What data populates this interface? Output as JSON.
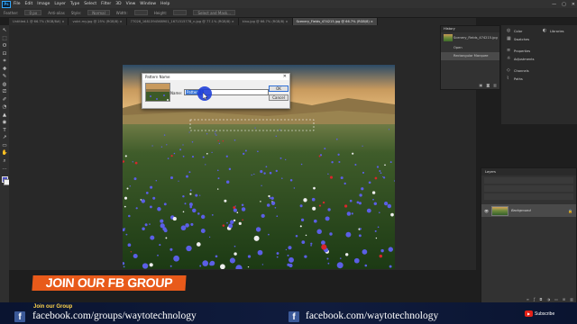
{
  "menubar": {
    "logo": "Ps",
    "items": [
      "File",
      "Edit",
      "Image",
      "Layer",
      "Type",
      "Select",
      "Filter",
      "3D",
      "View",
      "Window",
      "Help"
    ],
    "window_controls": [
      "—",
      "▢",
      "✕"
    ]
  },
  "options_bar": {
    "items": [
      "Feather:",
      "0 px",
      "Anti-alias",
      "Style:",
      "Normal",
      "Width:",
      "Height:",
      "Select and Mask..."
    ]
  },
  "tabs": [
    {
      "label": "Untitled-1 @ 66.7% (RGB/8#) ×",
      "active": false
    },
    {
      "label": "vokri-my.jpg @ 25% (RGB/8) ×",
      "active": false
    },
    {
      "label": "77026_1681394568901_1671515778_n.jpg @ 77.1% (RGB/8) ×",
      "active": false
    },
    {
      "label": "kino.jpg @ 66.7% (RGB/8) ×",
      "active": false
    },
    {
      "label": "Scenery_Fields_474215.jpg @ 66.7% (RGB/8) ×",
      "active": true
    }
  ],
  "dialog": {
    "title": "Pattern Name",
    "close": "✕",
    "name_label": "Name:",
    "name_value": "Pattern 1",
    "ok_label": "OK",
    "cancel_label": "Cancel"
  },
  "history": {
    "title": "History",
    "snapshot": "Scenery_Fields_474215.jpg",
    "items": [
      "Open",
      "Rectangular Marquee"
    ],
    "selected_index": 1
  },
  "side_panels": [
    {
      "icon": "◎",
      "label": "Color"
    },
    {
      "icon": "▦",
      "label": "Swatches"
    },
    {
      "icon": "◐",
      "label": "Libraries"
    },
    {
      "icon": "≡",
      "label": "Properties"
    },
    {
      "icon": "☼",
      "label": "Adjustments"
    },
    {
      "icon": "◇",
      "label": "Channels"
    },
    {
      "icon": "⌇",
      "label": "Paths"
    }
  ],
  "layers": {
    "title": "Layers",
    "layer_name": "Background",
    "visibility_icon": "👁",
    "lock_icon": "🔒"
  },
  "toolbar_tools": [
    "↖",
    "⬚",
    "ʘ",
    "⊡",
    "⌗",
    "✚",
    "✎",
    "◍",
    "⎚",
    "✐",
    "◔",
    "▲",
    "◉",
    "T",
    "↗",
    "▭",
    "✋",
    "⌕",
    "…"
  ],
  "overlay": {
    "banner": "JOIN OUR FB GROUP",
    "join_text": "Join our Group",
    "group_url": "facebook.com/groups/waytotechnology",
    "page_url": "facebook.com/waytotechnology",
    "fb_icon": "f",
    "subscribe": "Subscribe",
    "yt_icon": "▶"
  },
  "colors": {
    "foreground": "#4b4fc0",
    "background": "#f2f2f2",
    "banner": "#e85a1a",
    "selection_highlight": "#2f6fd6"
  }
}
